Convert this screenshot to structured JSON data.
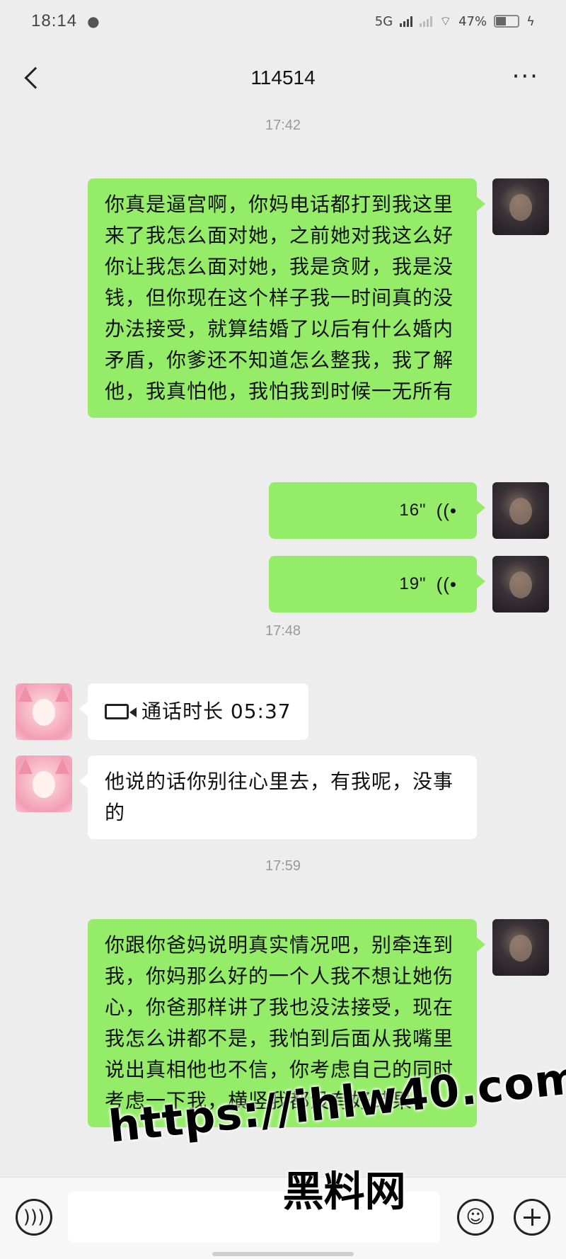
{
  "status_bar": {
    "time": "18:14",
    "network": "5G",
    "battery": "47%",
    "battery_level": 0.47
  },
  "header": {
    "title": "114514",
    "more_label": "···"
  },
  "messages": [
    {
      "type": "timestamp",
      "text": "17:42"
    },
    {
      "type": "text",
      "from": "me",
      "text": "你真是逼宫啊，你妈电话都打到我这里来了我怎么面对她，之前她对我这么好你让我怎么面对她，我是贪财，我是没钱，但你现在这个样子我一时间真的没办法接受，就算结婚了以后有什么婚内矛盾，你爹还不知道怎么整我，我了解他，我真怕他，我怕我到时候一无所有"
    },
    {
      "type": "voice",
      "from": "me",
      "duration": "16\""
    },
    {
      "type": "voice",
      "from": "me",
      "duration": "19\""
    },
    {
      "type": "timestamp",
      "text": "17:48"
    },
    {
      "type": "video_call",
      "from": "them",
      "text": "通话时长 05:37"
    },
    {
      "type": "text",
      "from": "them",
      "text": "他说的话你别往心里去，有我呢，没事的"
    },
    {
      "type": "timestamp",
      "text": "17:59"
    },
    {
      "type": "text",
      "from": "me",
      "text": "你跟你爸妈说明真实情况吧，别牵连到我，你妈那么好的一个人我不想让她伤心，你爸那样讲了我也没法接受，现在我怎么讲都不是，我怕到后面从我嘴里说出真相他也不信，你考虑自己的同时考虑一下我，横竖我都没有好结果"
    }
  ],
  "input_bar": {
    "voice_icon": "voice-input-icon",
    "emoji_icon": "emoji-icon",
    "plus_icon": "plus-icon",
    "input_value": ""
  },
  "watermark": {
    "url": "https://ihlw40.com",
    "brand": "黑料网"
  },
  "colors": {
    "background": "#ededed",
    "my_bubble": "#95ec69",
    "their_bubble": "#ffffff",
    "timestamp": "#999999"
  }
}
